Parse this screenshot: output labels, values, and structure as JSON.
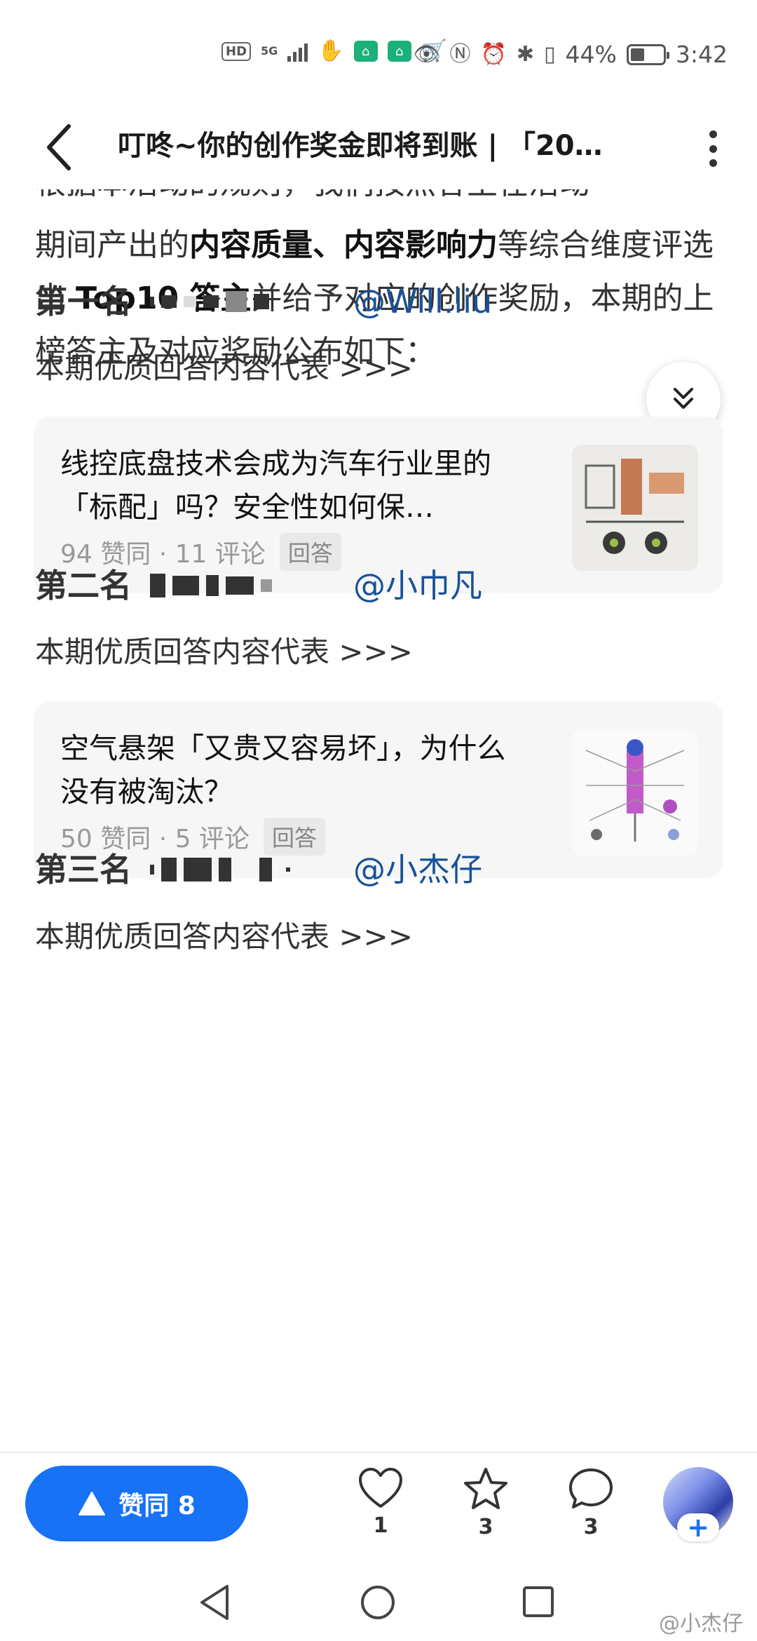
{
  "status_bar": {
    "hd": "HD",
    "network": "5G",
    "battery_text": "44%",
    "battery_level": 0.44,
    "time": "3:42"
  },
  "nav": {
    "title": "叮咚~你的创作奖金即将到账 | 「20…"
  },
  "article": {
    "partial_line": "根据本活动的规则，我们按照答主在活动",
    "intro_1": "期间产出的",
    "intro_bold_1": "内容质量、内容影响力",
    "intro_2": "等综合维度评选出 ",
    "intro_bold_2": "Top10 答主",
    "intro_3": "并给予对应的创作奖励，本期的上榜答主及对应奖励公布如下：",
    "ranks": [
      {
        "label": "第一名",
        "mention": "@Will.liu",
        "represent": "本期优质回答内容代表 >>>",
        "card": {
          "title": "线控底盘技术会成为汽车行业里的「标配」吗？安全性如何保…",
          "meta": "94 赞同 · 11 评论",
          "tag": "回答"
        }
      },
      {
        "label": "第二名",
        "mention": "@小巾凡",
        "represent": "本期优质回答内容代表 >>>",
        "card": {
          "title": "空气悬架「又贵又容易坏」，为什么没有被淘汰？",
          "meta": "50 赞同 · 5 评论",
          "tag": "回答"
        }
      },
      {
        "label": "第三名",
        "mention": "@小杰仔",
        "represent": "本期优质回答内容代表 >>>"
      }
    ]
  },
  "action_bar": {
    "agree_label": "赞同 8",
    "like_count": "1",
    "star_count": "3",
    "comment_count": "3",
    "plus": "+"
  },
  "watermark": "@小杰仔",
  "colors": {
    "accent": "#1772f6",
    "mention": "#175199"
  }
}
